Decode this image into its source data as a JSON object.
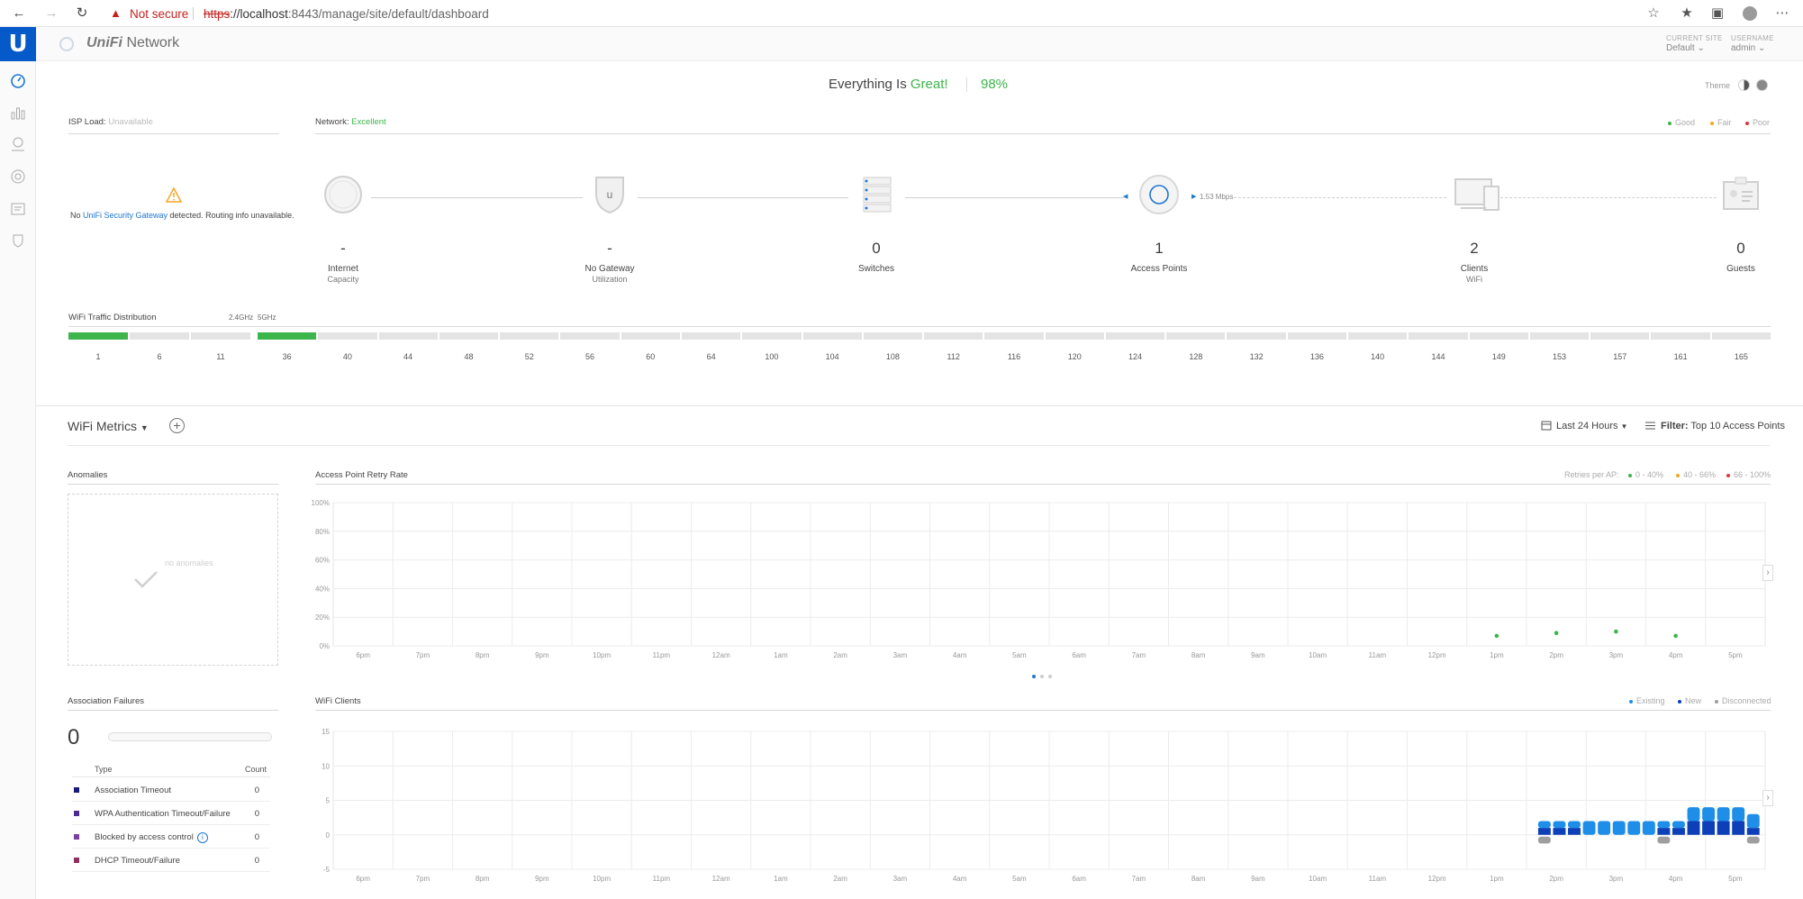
{
  "browser": {
    "security_label": "Not secure",
    "url_scheme": "https",
    "url_host": "://localhost",
    "url_rest": ":8443/manage/site/default/dashboard"
  },
  "header": {
    "brand_italic": "UniFi",
    "brand_rest": " Network",
    "current_site_label": "CURRENT SITE",
    "current_site_value": "Default",
    "username_label": "USERNAME",
    "username_value": "admin"
  },
  "status": {
    "prefix": "Everything Is ",
    "great": "Great!",
    "percent": "98%",
    "theme_label": "Theme"
  },
  "isp": {
    "label": "ISP Load: ",
    "value": "Unavailable",
    "message_prefix": "No ",
    "message_link": "UniFi Security Gateway",
    "message_suffix": " detected. Routing info unavailable."
  },
  "network": {
    "label": "Network: ",
    "value": "Excellent",
    "legend": [
      "Good",
      "Fair",
      "Poor"
    ],
    "link_speed": "1.53 Mbps"
  },
  "topology": [
    {
      "value": "-",
      "label": "Internet",
      "sub": "Capacity"
    },
    {
      "value": "-",
      "label": "No Gateway",
      "sub": "Utilization"
    },
    {
      "value": "0",
      "label": "Switches",
      "sub": ""
    },
    {
      "value": "1",
      "label": "Access Points",
      "sub": ""
    },
    {
      "value": "2",
      "label": "Clients",
      "sub": "WiFi"
    },
    {
      "value": "0",
      "label": "Guests",
      "sub": ""
    }
  ],
  "wifi_dist": {
    "title": "WiFi Traffic Distribution",
    "band_24": "2.4GHz",
    "band_5": "5GHz",
    "channels_24": [
      "1",
      "6",
      "11"
    ],
    "channels_5": [
      "36",
      "40",
      "44",
      "48",
      "52",
      "56",
      "60",
      "64",
      "100",
      "104",
      "108",
      "112",
      "116",
      "120",
      "124",
      "128",
      "132",
      "136",
      "140",
      "144",
      "149",
      "153",
      "157",
      "161",
      "165"
    ],
    "usage_24": [
      1,
      0,
      0
    ],
    "usage_5": [
      1,
      0,
      0,
      0,
      0,
      0,
      0,
      0,
      0,
      0,
      0,
      0,
      0,
      0,
      0,
      0,
      0,
      0,
      0,
      0,
      0,
      0,
      0,
      0,
      0
    ]
  },
  "metrics": {
    "title": "WiFi Metrics",
    "range": "Last 24 Hours",
    "filter_label": "Filter:",
    "filter_value": "Top 10 Access Points"
  },
  "anomalies": {
    "title": "Anomalies",
    "empty_text": "no anomalies"
  },
  "retry": {
    "title": "Access Point Retry Rate",
    "legend_title": "Retries per AP:",
    "legend": [
      "0 - 40%",
      "40 - 66%",
      "66 - 100%"
    ]
  },
  "assoc": {
    "title": "Association Failures",
    "count": "0",
    "col_type": "Type",
    "col_count": "Count",
    "rows": [
      {
        "type": "Association Timeout",
        "count": "0",
        "color": "#1a1a7a"
      },
      {
        "type": "WPA Authentication Timeout/Failure",
        "count": "0",
        "color": "#4b2c8f"
      },
      {
        "type": "Blocked by access control",
        "count": "0",
        "color": "#7b3f9e"
      },
      {
        "type": "DHCP Timeout/Failure",
        "count": "0",
        "color": "#8f2f5e"
      }
    ]
  },
  "clients_chart_meta": {
    "title": "WiFi Clients",
    "legend": [
      "Existing",
      "New",
      "Disconnected"
    ]
  },
  "colors": {
    "good": "#3cb54a",
    "fair": "#f5a623",
    "poor": "#e0343b",
    "existing": "#1e8ee8",
    "new": "#0d3fb8",
    "disconnected": "#9e9e9e",
    "brand": "#0559c9"
  },
  "chart_data": [
    {
      "type": "scatter",
      "title": "Access Point Retry Rate",
      "x": [
        "6pm",
        "7pm",
        "8pm",
        "9pm",
        "10pm",
        "11pm",
        "12am",
        "1am",
        "2am",
        "3am",
        "4am",
        "5am",
        "6am",
        "7am",
        "8am",
        "9am",
        "10am",
        "11am",
        "12pm",
        "1pm",
        "2pm",
        "3pm",
        "4pm",
        "5pm"
      ],
      "y_ticks": [
        "0%",
        "20%",
        "40%",
        "60%",
        "80%",
        "100%"
      ],
      "ylim": [
        0,
        100
      ],
      "series": [
        {
          "name": "0 - 40%",
          "points": [
            [
              19,
              7
            ],
            [
              20,
              9
            ],
            [
              21,
              10
            ],
            [
              22,
              7
            ]
          ]
        }
      ]
    },
    {
      "type": "bar",
      "title": "WiFi Clients",
      "x": [
        "6pm",
        "7pm",
        "8pm",
        "9pm",
        "10pm",
        "11pm",
        "12am",
        "1am",
        "2am",
        "3am",
        "4am",
        "5am",
        "6am",
        "7am",
        "8am",
        "9am",
        "10am",
        "11am",
        "12pm",
        "1pm",
        "2pm",
        "3pm",
        "4pm",
        "5pm"
      ],
      "y_ticks": [
        "-5",
        "0",
        "5",
        "10",
        "15"
      ],
      "ylim": [
        -5,
        15
      ],
      "bars_x": [
        19.8,
        20.05,
        20.3,
        20.55,
        20.8,
        21.05,
        21.3,
        21.55,
        21.8,
        22.05,
        22.3,
        22.55,
        22.8,
        23.05,
        23.3
      ],
      "series": [
        {
          "name": "Existing",
          "values": [
            1,
            1,
            1,
            2,
            2,
            2,
            2,
            2,
            1,
            1,
            2,
            2,
            2,
            2,
            2
          ]
        },
        {
          "name": "New",
          "values": [
            1,
            1,
            1,
            0,
            0,
            0,
            0,
            0,
            1,
            1,
            2,
            2,
            2,
            2,
            1
          ]
        },
        {
          "name": "Disconnected",
          "values": [
            -1,
            0,
            0,
            0,
            0,
            0,
            0,
            0,
            -1,
            0,
            0,
            0,
            0,
            0,
            -1
          ]
        }
      ]
    }
  ]
}
